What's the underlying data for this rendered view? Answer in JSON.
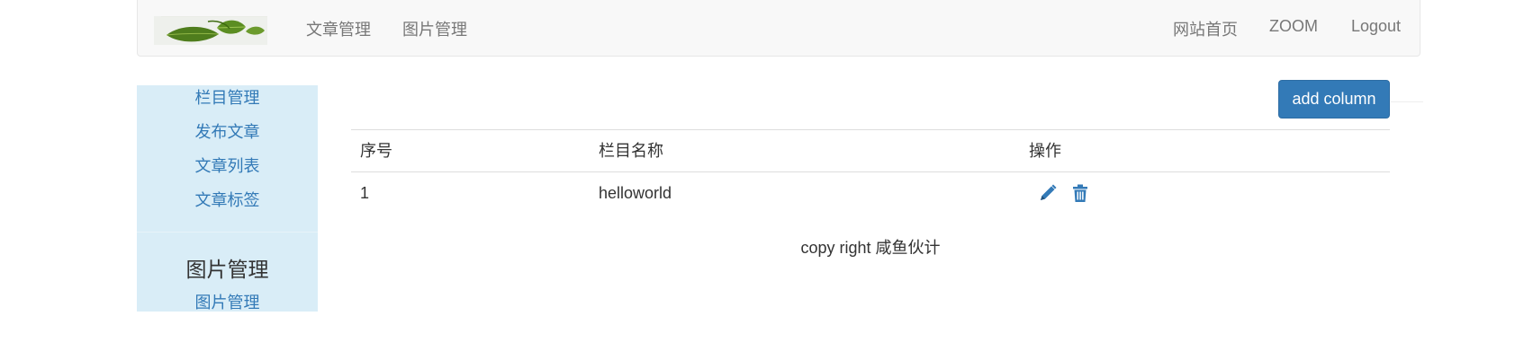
{
  "navbar": {
    "brand_logo": "leaf-logo",
    "left_items": [
      "文章管理",
      "图片管理"
    ],
    "right_items": [
      "网站首页",
      "ZOOM",
      "Logout"
    ]
  },
  "sidebar": {
    "article_section_items": [
      "栏目管理",
      "发布文章",
      "文章列表",
      "文章标签"
    ],
    "image_section_heading": "图片管理",
    "image_section_items": [
      "图片管理"
    ]
  },
  "toolbar": {
    "add_column_label": "add column"
  },
  "table": {
    "headers": [
      "序号",
      "栏目名称",
      "操作"
    ],
    "rows": [
      {
        "index": "1",
        "name": "helloworld",
        "actions": [
          "pencil-icon",
          "trash-icon"
        ]
      }
    ]
  },
  "footer": {
    "text": "copy right 咸鱼伙计"
  },
  "colors": {
    "navbar_bg": "#f8f8f8",
    "nav_text": "#777777",
    "sidebar_bg": "#d9edf7",
    "link": "#337ab7",
    "primary_button": "#337ab7",
    "text": "#333333"
  }
}
